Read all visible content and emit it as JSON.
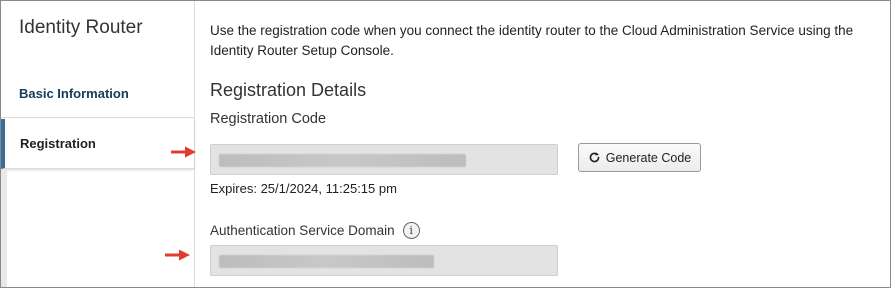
{
  "sidebar": {
    "title": "Identity Router",
    "items": [
      {
        "label": "Basic Information",
        "active": false
      },
      {
        "label": "Registration",
        "active": true
      }
    ]
  },
  "main": {
    "intro": "Use the registration code when you connect the identity router to the Cloud Administration Service using the Identity Router Setup Console.",
    "section_title": "Registration Details",
    "registration_code": {
      "label": "Registration Code",
      "value": "",
      "expires": "Expires: 25/1/2024, 11:25:15 pm"
    },
    "generate_button": {
      "label": "Generate Code",
      "icon": "refresh-icon"
    },
    "auth_domain": {
      "label": "Authentication Service Domain",
      "info_icon": "i",
      "value": ""
    }
  },
  "colors": {
    "annotation_arrow": "#e03c31",
    "active_nav_border": "#3a6f99",
    "nav_text": "#173a5c",
    "field_bg": "#e3e3e3"
  }
}
